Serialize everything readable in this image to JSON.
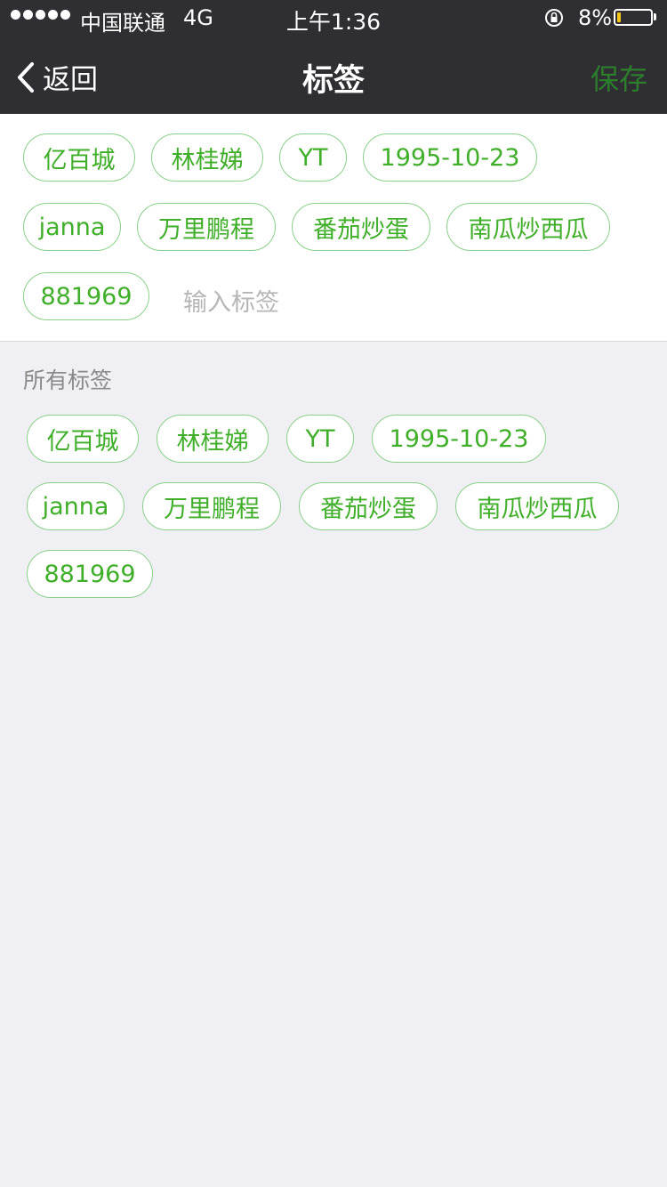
{
  "status_bar": {
    "carrier": "中国联通",
    "network": "4G",
    "time": "上午1:36",
    "battery_percent": "8%",
    "battery_level": 0.08
  },
  "nav": {
    "back_label": "返回",
    "title": "标签",
    "save_label": "保存"
  },
  "selected_tags": [
    "亿百城",
    "林桂娣",
    "YT",
    "1995-10-23",
    "janna",
    "万里鹏程",
    "番茄炒蛋",
    "南瓜炒西瓜",
    "881969"
  ],
  "input": {
    "placeholder": "输入标签"
  },
  "all_tags_section": {
    "label": "所有标签",
    "tags": [
      "亿百城",
      "林桂娣",
      "YT",
      "1995-10-23",
      "janna",
      "万里鹏程",
      "番茄炒蛋",
      "南瓜炒西瓜",
      "881969"
    ]
  },
  "colors": {
    "accent_green": "#3fae29",
    "chip_border": "#8ad08a",
    "nav_bg": "#2f2f33",
    "save_disabled": "#2c7d2c"
  }
}
